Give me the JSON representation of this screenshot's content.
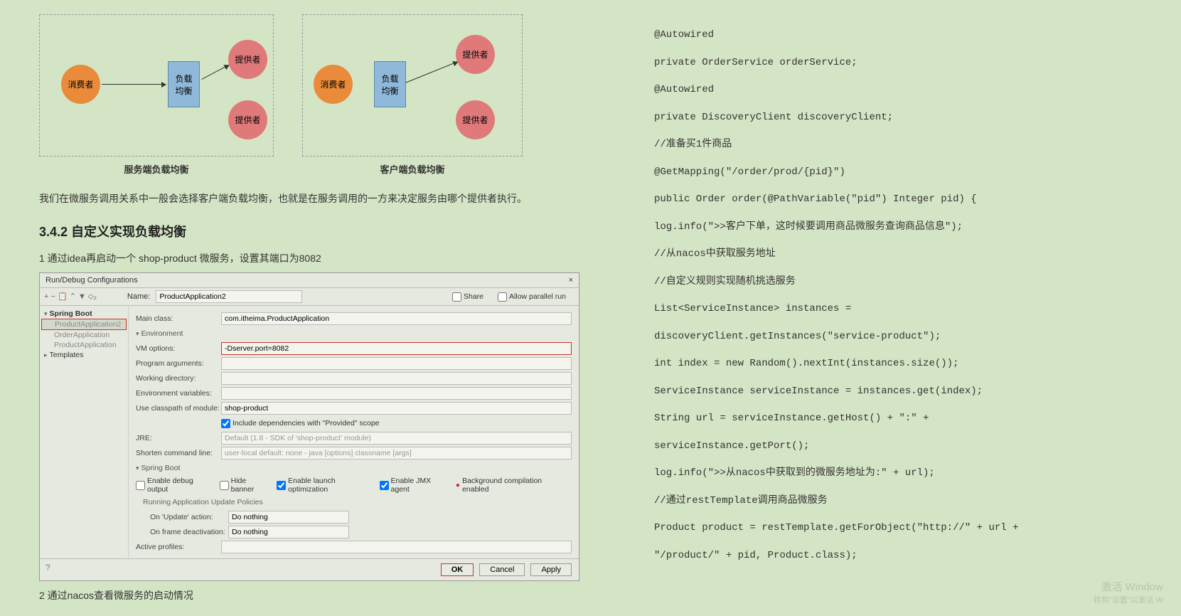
{
  "diagram": {
    "consumer_label": "消费者",
    "provider_label": "提供者",
    "balancer_line1": "负载",
    "balancer_line2": "均衡",
    "server_side_label": "服务端负载均衡",
    "client_side_label": "客户端负载均衡"
  },
  "article": {
    "paragraph1": "我们在微服务调用关系中一般会选择客户端负载均衡，也就是在服务调用的一方来决定服务由哪个提供者执行。",
    "section_heading": "3.4.2 自定义实现负载均衡",
    "step1": "1 通过idea再启动一个 shop-product 微服务，设置其端口为8082",
    "step2": "2 通过nacos查看微服务的启动情况"
  },
  "ide": {
    "title": "Run/Debug Configurations",
    "close_x": "×",
    "toolbar_icons": "+  −  📋  ⌃  ▼  ⬦₂",
    "name_label": "Name:",
    "name_value": "ProductApplication2",
    "share_label": "Share",
    "allow_parallel_label": "Allow parallel run",
    "tree": {
      "spring_boot": "Spring Boot",
      "app1": "ProductApplication2",
      "app2": "OrderApplication",
      "app3": "ProductApplication",
      "templates": "Templates"
    },
    "form": {
      "main_class_label": "Main class:",
      "main_class_value": "com.itheima.ProductApplication",
      "environment_header": "Environment",
      "vm_options_label": "VM options:",
      "vm_options_value": "-Dserver.port=8082",
      "program_args_label": "Program arguments:",
      "working_dir_label": "Working directory:",
      "env_vars_label": "Environment variables:",
      "classpath_label": "Use classpath of module:",
      "classpath_value": "shop-product",
      "include_deps_label": "Include dependencies with \"Provided\" scope",
      "jre_label": "JRE:",
      "jre_value": "Default (1.8 - SDK of 'shop-product' module)",
      "shorten_label": "Shorten command line:",
      "shorten_value": "user-local default: none - java [options] classname [args]",
      "spring_boot_header": "Spring Boot",
      "enable_debug_label": "Enable debug output",
      "hide_banner_label": "Hide banner",
      "enable_launch_label": "Enable launch optimization",
      "enable_jmx_label": "Enable JMX agent",
      "background_label": "Background compilation enabled",
      "running_policies_header": "Running Application Update Policies",
      "on_update_label": "On 'Update' action:",
      "on_update_value": "Do nothing",
      "on_frame_label": "On frame deactivation:",
      "on_frame_value": "Do nothing",
      "active_profiles_label": "Active profiles:"
    },
    "buttons": {
      "ok": "OK",
      "cancel": "Cancel",
      "apply": "Apply"
    }
  },
  "code": [
    "@Autowired",
    "private OrderService orderService;",
    "@Autowired",
    "private DiscoveryClient discoveryClient;",
    "//准备买1件商品",
    "@GetMapping(\"/order/prod/{pid}\")",
    "public Order order(@PathVariable(\"pid\") Integer pid) {",
    "log.info(\">>客户下单，这时候要调用商品微服务查询商品信息\");",
    "//从nacos中获取服务地址",
    "//自定义规则实现随机挑选服务",
    "List<ServiceInstance> instances = discoveryClient.getInstances(\"service-product\");",
    "int index = new Random().nextInt(instances.size());",
    "ServiceInstance serviceInstance = instances.get(index);",
    "String url = serviceInstance.getHost() + \":\" + serviceInstance.getPort();",
    "log.info(\">>从nacos中获取到的微服务地址为:\" + url);",
    "//通过restTemplate调用商品微服务",
    "Product product = restTemplate.getForObject(\"http://\" + url + \"/product/\" + pid, Product.class);"
  ],
  "watermark": {
    "line1": "激活 Window",
    "line2": "转到\"设置\"以激活 W"
  }
}
